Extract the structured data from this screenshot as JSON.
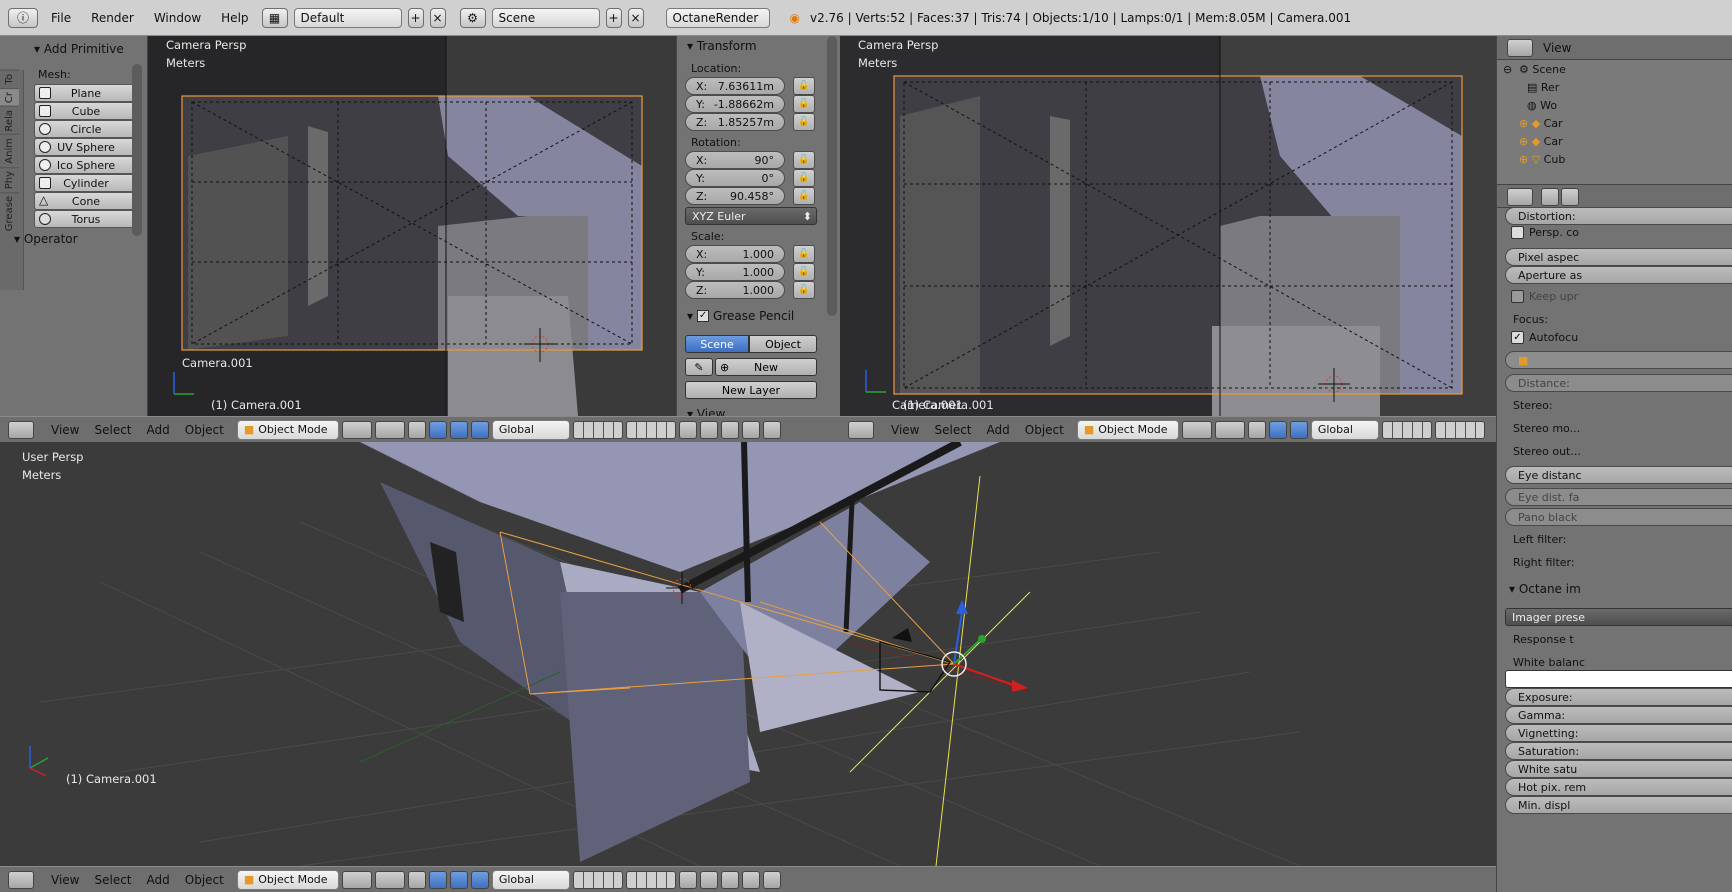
{
  "topbar": {
    "menus": [
      "File",
      "Render",
      "Window",
      "Help"
    ],
    "screen_layout": "Default",
    "scene": "Scene",
    "render_engine": "OctaneRender",
    "stats": "v2.76 | Verts:52 | Faces:37 | Tris:74 | Objects:1/10 | Lamps:0/1 | Mem:8.05M | Camera.001"
  },
  "tool_shelf": {
    "tabs": [
      "To",
      "Cr",
      "Rela",
      "Anim",
      "Phy",
      "Grease"
    ],
    "add_primitive_title": "Add Primitive",
    "mesh_label": "Mesh:",
    "mesh_items": [
      "Plane",
      "Cube",
      "Circle",
      "UV Sphere",
      "Ico Sphere",
      "Cylinder",
      "Cone",
      "Torus"
    ],
    "operator_title": "Operator"
  },
  "viewport_left": {
    "persp": "Camera Persp",
    "units": "Meters",
    "camera_name": "Camera.001",
    "object_label": "(1) Camera.001"
  },
  "transform_panel": {
    "title": "Transform",
    "location_label": "Location:",
    "location": [
      {
        "axis": "X:",
        "value": "7.63611m"
      },
      {
        "axis": "Y:",
        "value": "-1.88662m"
      },
      {
        "axis": "Z:",
        "value": "1.85257m"
      }
    ],
    "rotation_label": "Rotation:",
    "rotation": [
      {
        "axis": "X:",
        "value": "90°"
      },
      {
        "axis": "Y:",
        "value": "0°"
      },
      {
        "axis": "Z:",
        "value": "90.458°"
      }
    ],
    "rotation_mode": "XYZ Euler",
    "scale_label": "Scale:",
    "scale": [
      {
        "axis": "X:",
        "value": "1.000"
      },
      {
        "axis": "Y:",
        "value": "1.000"
      },
      {
        "axis": "Z:",
        "value": "1.000"
      }
    ],
    "grease_title": "Grease Pencil",
    "grease_scene": "Scene",
    "grease_object": "Object",
    "grease_new": "New",
    "grease_new_layer": "New Layer",
    "view_title": "View"
  },
  "viewport_right": {
    "persp": "Camera Persp",
    "units": "Meters",
    "object_label": "(1) Camera.001",
    "camera_name": "Camera.001"
  },
  "viewport_bottom": {
    "persp": "User Persp",
    "units": "Meters",
    "object_label": "(1) Camera.001"
  },
  "header": {
    "view": "View",
    "select": "Select",
    "add": "Add",
    "object": "Object",
    "mode": "Object Mode",
    "orientation": "Global"
  },
  "outliner": {
    "view": "View",
    "items": [
      "Scene",
      "Rer",
      "Wo",
      "Car",
      "Car",
      "Cub"
    ]
  },
  "camera_props": {
    "distortion": "Distortion:",
    "persp_correction": "Persp. co",
    "pixel_aspect": "Pixel aspec",
    "aperture_aspect": "Aperture as",
    "keep_upright": "Keep upr",
    "focus_label": "Focus:",
    "autofocus": "Autofocu",
    "distance": "Distance:",
    "stereo": "Stereo:",
    "stereo_mode": "Stereo mo...",
    "stereo_out": "Stereo out...",
    "eye_distance": "Eye distanc",
    "eye_dist_fa": "Eye dist. fa",
    "pano_black": "Pano black",
    "left_filter": "Left filter:",
    "right_filter": "Right filter:",
    "octane_imager": "Octane im",
    "imager_preset": "Imager prese",
    "response": "Response t",
    "white_balance": "White balanc",
    "exposure": "Exposure:",
    "gamma": "Gamma:",
    "vignetting": "Vignetting:",
    "saturation": "Saturation:",
    "white_saturation": "White satu",
    "hot_pixel": "Hot pix. rem",
    "min_display": "Min. displ"
  }
}
